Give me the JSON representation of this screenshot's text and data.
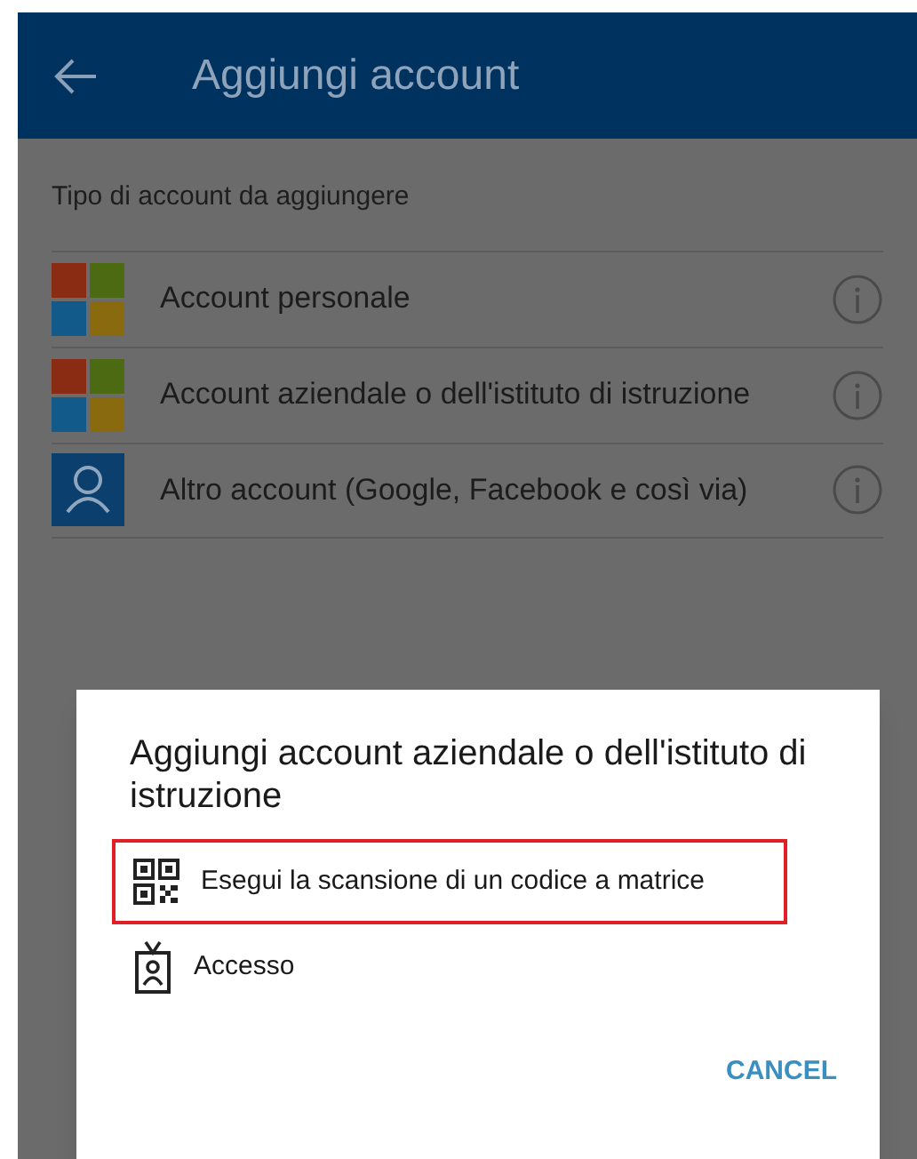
{
  "header": {
    "title": "Aggiungi account"
  },
  "section_label": "Tipo di account da aggiungere",
  "accounts": [
    {
      "kind": "windows",
      "label": "Account personale"
    },
    {
      "kind": "windows",
      "label": "Account aziendale o dell'istituto di istruzione"
    },
    {
      "kind": "person",
      "label": "Altro account (Google, Facebook e così via)"
    }
  ],
  "dialog": {
    "title": "Aggiungi account aziendale o dell'istituto di istruzione",
    "options": [
      {
        "kind": "qr",
        "label": "Esegui la scansione di un codice a matrice",
        "highlighted": true
      },
      {
        "kind": "badge",
        "label": "Accesso",
        "highlighted": false
      }
    ],
    "button": "CANCEL"
  }
}
